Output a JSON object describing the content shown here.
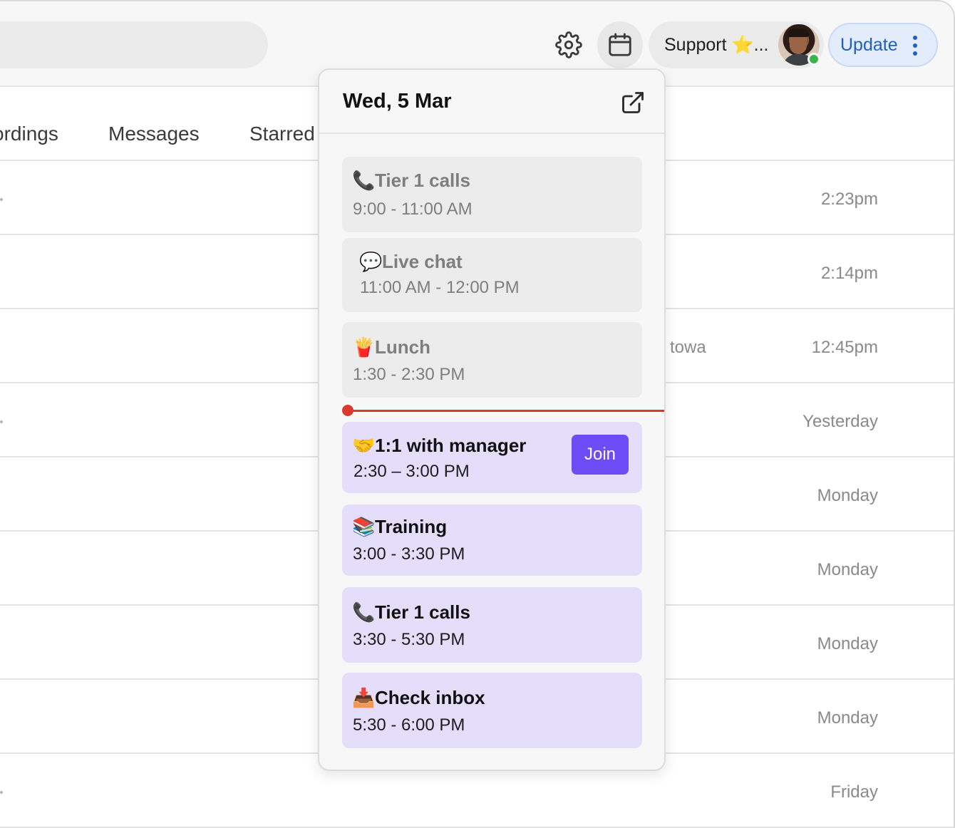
{
  "topbar": {
    "support_label": "Support ⭐...",
    "update_label": "Update"
  },
  "tabs": [
    {
      "label": "ordings"
    },
    {
      "label": "Messages"
    },
    {
      "label": "Starred"
    }
  ],
  "rows": [
    {
      "time": "2:23pm",
      "extra": ""
    },
    {
      "time": "2:14pm",
      "extra": ""
    },
    {
      "time": "12:45pm",
      "extra": "towa"
    },
    {
      "time": "Yesterday",
      "extra": ""
    },
    {
      "time": "Monday",
      "extra": ""
    },
    {
      "time": "Monday",
      "extra": ""
    },
    {
      "time": "Monday",
      "extra": ""
    },
    {
      "time": "Monday",
      "extra": ""
    },
    {
      "time": "Friday",
      "extra": ""
    }
  ],
  "calendar": {
    "date": "Wed, 5 Mar",
    "events": [
      {
        "emoji": "📞",
        "title": "Tier 1 calls",
        "time": "9:00 - 11:00 AM",
        "state": "past"
      },
      {
        "emoji": "💬",
        "title": "Live chat",
        "time": "11:00 AM - 12:00 PM",
        "state": "past"
      },
      {
        "emoji": "🍟",
        "title": "Lunch",
        "time": "1:30 - 2:30 PM",
        "state": "past"
      },
      {
        "emoji": "🤝",
        "title": "1:1 with manager",
        "time": "2:30 – 3:00 PM",
        "state": "current",
        "join_label": "Join"
      },
      {
        "emoji": "📚",
        "title": "Training",
        "time": "3:00 - 3:30 PM",
        "state": "future"
      },
      {
        "emoji": "📞",
        "title": "Tier 1 calls",
        "time": "3:30 - 5:30 PM",
        "state": "future"
      },
      {
        "emoji": "📥",
        "title": "Check inbox",
        "time": "5:30 - 6:00 PM",
        "state": "future"
      }
    ]
  },
  "colors": {
    "accent": "#6d4cf5",
    "now_line": "#d93a2f",
    "update_text": "#1f5fbf",
    "online": "#39b54a"
  },
  "icons": [
    "gear-icon",
    "calendar-icon",
    "external-link-icon",
    "kebab-menu-icon",
    "avatar"
  ]
}
